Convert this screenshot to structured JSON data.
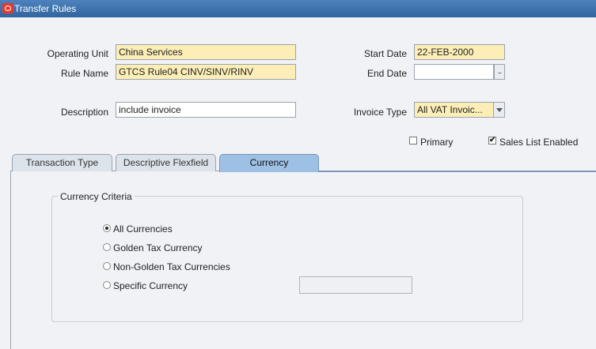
{
  "window": {
    "title": "Transfer Rules"
  },
  "form": {
    "operating_unit_label": "Operating Unit",
    "operating_unit_value": "China Services",
    "rule_name_label": "Rule Name",
    "rule_name_value": "GTCS Rule04 CINV/SINV/RINV",
    "description_label": "Description",
    "description_value": "include invoice",
    "start_date_label": "Start Date",
    "start_date_value": "22-FEB-2000",
    "end_date_label": "End Date",
    "end_date_value": "",
    "lov_button_glyph": "...",
    "invoice_type_label": "Invoice Type",
    "invoice_type_value": "All VAT Invoic...",
    "primary_label": "Primary",
    "primary_checked": false,
    "sales_list_label": "Sales List Enabled",
    "sales_list_checked": true
  },
  "tabs": [
    {
      "label": "Transaction Type",
      "active": false
    },
    {
      "label": "Descriptive Flexfield",
      "active": false
    },
    {
      "label": "Currency",
      "active": true
    }
  ],
  "currency": {
    "group_title": "Currency Criteria",
    "options": [
      {
        "label": "All Currencies",
        "selected": true
      },
      {
        "label": "Golden Tax Currency",
        "selected": false
      },
      {
        "label": "Non-Golden Tax Currencies",
        "selected": false
      },
      {
        "label": "Specific Currency",
        "selected": false
      }
    ],
    "specific_currency_value": ""
  },
  "colors": {
    "titlebar": "#3a6ea5",
    "required_field": "#fceeb6",
    "active_tab": "#9ec0e4"
  }
}
